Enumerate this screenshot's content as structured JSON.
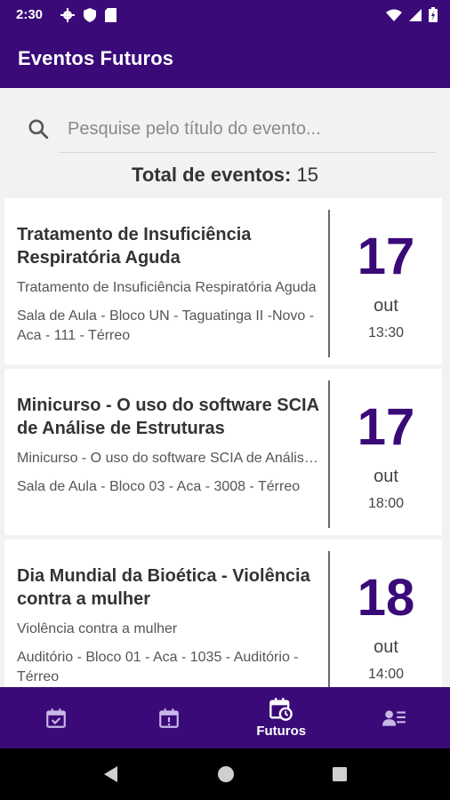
{
  "status_bar": {
    "time": "2:30"
  },
  "app_bar": {
    "title": "Eventos Futuros"
  },
  "search": {
    "placeholder": "Pesquise pelo título do evento..."
  },
  "summary": {
    "label": "Total de eventos:",
    "count": "15"
  },
  "events": [
    {
      "title": "Tratamento de Insuficiência Respiratória Aguda",
      "description": "Tratamento de Insuficiência Respiratória Aguda",
      "location": "Sala de Aula - Bloco UN - Taguatinga II -Novo - Aca - 111 - Térreo",
      "day": "17",
      "month": "out",
      "time": "13:30"
    },
    {
      "title": "Minicurso - O uso do software SCIA de Análise de Estruturas",
      "description": "Minicurso - O uso do software SCIA de Análise de Estruturas",
      "location": "Sala de Aula - Bloco 03 - Aca - 3008 - Térreo",
      "day": "17",
      "month": "out",
      "time": "18:00"
    },
    {
      "title": "Dia Mundial da Bioética - Violência contra a mulher",
      "description": "Violência contra a mulher",
      "location": "Auditório - Bloco 01 - Aca - 1035 - Auditório - Térreo",
      "day": "18",
      "month": "out",
      "time": "14:00"
    }
  ],
  "bottom_nav": {
    "items": [
      {
        "icon": "calendar-check-icon",
        "label": ""
      },
      {
        "icon": "calendar-alert-icon",
        "label": ""
      },
      {
        "icon": "calendar-clock-icon",
        "label": "Futuros"
      },
      {
        "icon": "account-list-icon",
        "label": ""
      }
    ],
    "active_index": 2
  },
  "colors": {
    "primary": "#3a0a78",
    "background": "#f2f2f2",
    "card": "#ffffff"
  }
}
